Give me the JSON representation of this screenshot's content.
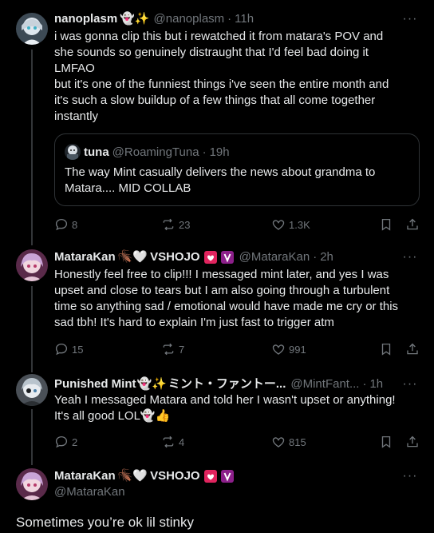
{
  "posts": [
    {
      "name": "nanoplasm",
      "name_emoji": "👻✨",
      "handle": "@nanoplasm",
      "time": "11h",
      "text_lines": [
        "i was gonna clip this but i rewatched it from matara's POV and",
        "she sounds so genuinely distraught that I'd feel bad doing it",
        "LMFAO",
        "but it's one of the funniest things i've seen the entire month and",
        "it's such a slow buildup of a few things that all come together",
        "instantly"
      ],
      "quote": {
        "name": "tuna",
        "handle": "@RoamingTuna",
        "time": "19h",
        "text_lines": [
          "The way Mint casually delivers the news about grandma to",
          "Matara.... MID COLLAB"
        ]
      },
      "stats": {
        "replies": "8",
        "reposts": "23",
        "likes": "1.3K"
      }
    },
    {
      "name": "MataraKan",
      "name_emoji": "🪳🤍",
      "name_suffix": "VSHOJO",
      "handle": "@MataraKan",
      "time": "2h",
      "text_lines": [
        "Honestly feel free to clip!!! I messaged mint later, and yes I was",
        "upset and close to tears but I am also going through a turbulent",
        "time so anything sad / emotional would have made me cry or this",
        "sad tbh! It's hard to explain I'm just fast to trigger atm"
      ],
      "stats": {
        "replies": "15",
        "reposts": "7",
        "likes": "991"
      }
    },
    {
      "name": "Punished Mint",
      "name_emoji": "👻✨",
      "name_suffix": "ミント・ファントー...",
      "handle": "@MintFant...",
      "time": "1h",
      "text_lines": [
        "Yeah I messaged Matara and told her I wasn't upset or anything!",
        "It's all good LOL👻👍"
      ],
      "stats": {
        "replies": "2",
        "reposts": "4",
        "likes": "815"
      }
    },
    {
      "name": "MataraKan",
      "name_emoji": "🪳🤍",
      "name_suffix": "VSHOJO",
      "handle": "@MataraKan",
      "text": "Sometimes you’re ok lil stinky"
    }
  ],
  "separator": "·",
  "more_glyph": "···",
  "colors": {
    "background": "#000000",
    "text": "#e7e9ea",
    "muted": "#71767b",
    "border": "#2f3336",
    "badge_pink": "#e0245e",
    "badge_purple": "#8c1f8a"
  },
  "icons": [
    "reply-icon",
    "repost-icon",
    "like-icon",
    "bookmark-icon",
    "share-icon",
    "more-icon",
    "heart-badge-icon",
    "verified-v-badge-icon"
  ]
}
